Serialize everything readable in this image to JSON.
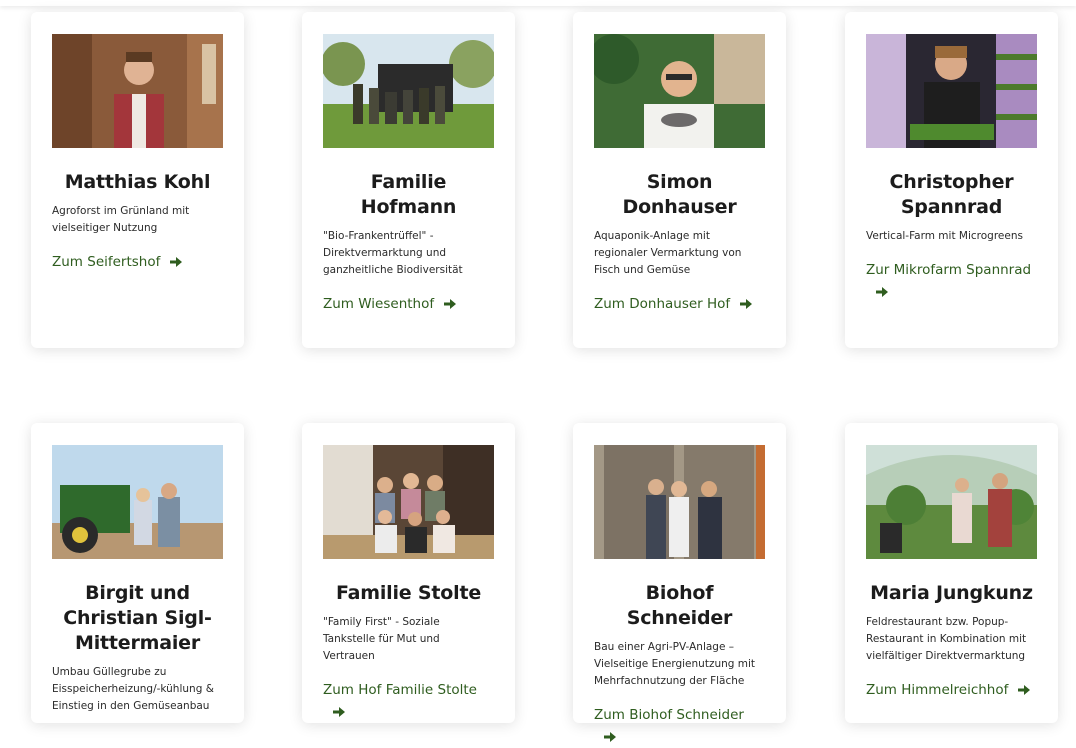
{
  "cards": [
    {
      "name": "Matthias Kohl",
      "description": "Agroforst im Grünland mit vielseitiger Nutzung",
      "link": "Zum Seifertshof"
    },
    {
      "name": "Familie Hofmann",
      "description": "\"Bio-Frankentrüffel\" - Direktvermarktung und ganzheitliche Biodiversität",
      "link": "Zum Wiesenthof"
    },
    {
      "name": "Simon Donhauser",
      "description": "Aquaponik-Anlage mit regionaler Vermarktung von Fisch und Gemüse",
      "link": "Zum Donhauser Hof"
    },
    {
      "name": "Christopher Spannrad",
      "description": "Vertical-Farm mit Microgreens",
      "link": "Zur Mikrofarm Spannrad"
    },
    {
      "name": "Birgit und Christian Sigl-Mittermaier",
      "description": "Umbau Güllegrube zu Eisspeicherheizung/-kühlung & Einstieg in den Gemüseanbau",
      "link": ""
    },
    {
      "name": "Familie Stolte",
      "description": "\"Family First\" - Soziale Tankstelle für Mut und Vertrauen",
      "link": "Zum Hof Familie Stolte"
    },
    {
      "name": "Biohof Schneider",
      "description": "Bau einer Agri-PV-Anlage – Vielseitige Energienutzung mit Mehrfachnutzung der Fläche",
      "link": "Zum Biohof Schneider"
    },
    {
      "name": "Maria Jungkunz",
      "description": "Feldrestaurant bzw. Popup-Restaurant in Kombination mit vielfältiger Direktvermarktung",
      "link": "Zum Himmelreichhof"
    }
  ],
  "colors": {
    "link": "#2f5d1f",
    "arrow": "#2f5d1f"
  },
  "icons": {
    "link_arrow": "arrow-right-icon"
  }
}
